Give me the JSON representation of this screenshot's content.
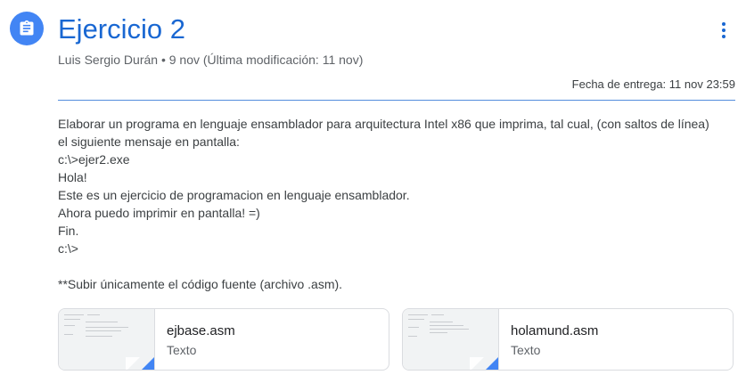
{
  "header": {
    "icon": "assignment-icon",
    "title": "Ejercicio 2",
    "meta": "Luis Sergio Durán • 9 nov (Última modificación: 11 nov)",
    "more_icon": "more-vert-icon",
    "due": "Fecha de entrega: 11 nov 23:59"
  },
  "instructions": {
    "lines": [
      "Elaborar un programa en lenguaje ensamblador para arquitectura Intel x86 que imprima, tal cual, (con saltos de línea)",
      "el siguiente mensaje en pantalla:",
      "c:\\>ejer2.exe",
      "Hola!",
      "Este es un ejercicio de programacion en lenguaje ensamblador.",
      "Ahora puedo imprimir en pantalla! =)",
      "Fin.",
      "c:\\>",
      "",
      "**Subir únicamente el código fuente (archivo .asm)."
    ]
  },
  "attachments": [
    {
      "name": "ejbase.asm",
      "type": "Texto"
    },
    {
      "name": "holamund.asm",
      "type": "Texto"
    }
  ],
  "colors": {
    "accent": "#1967d2",
    "icon_bg": "#4285f4"
  }
}
